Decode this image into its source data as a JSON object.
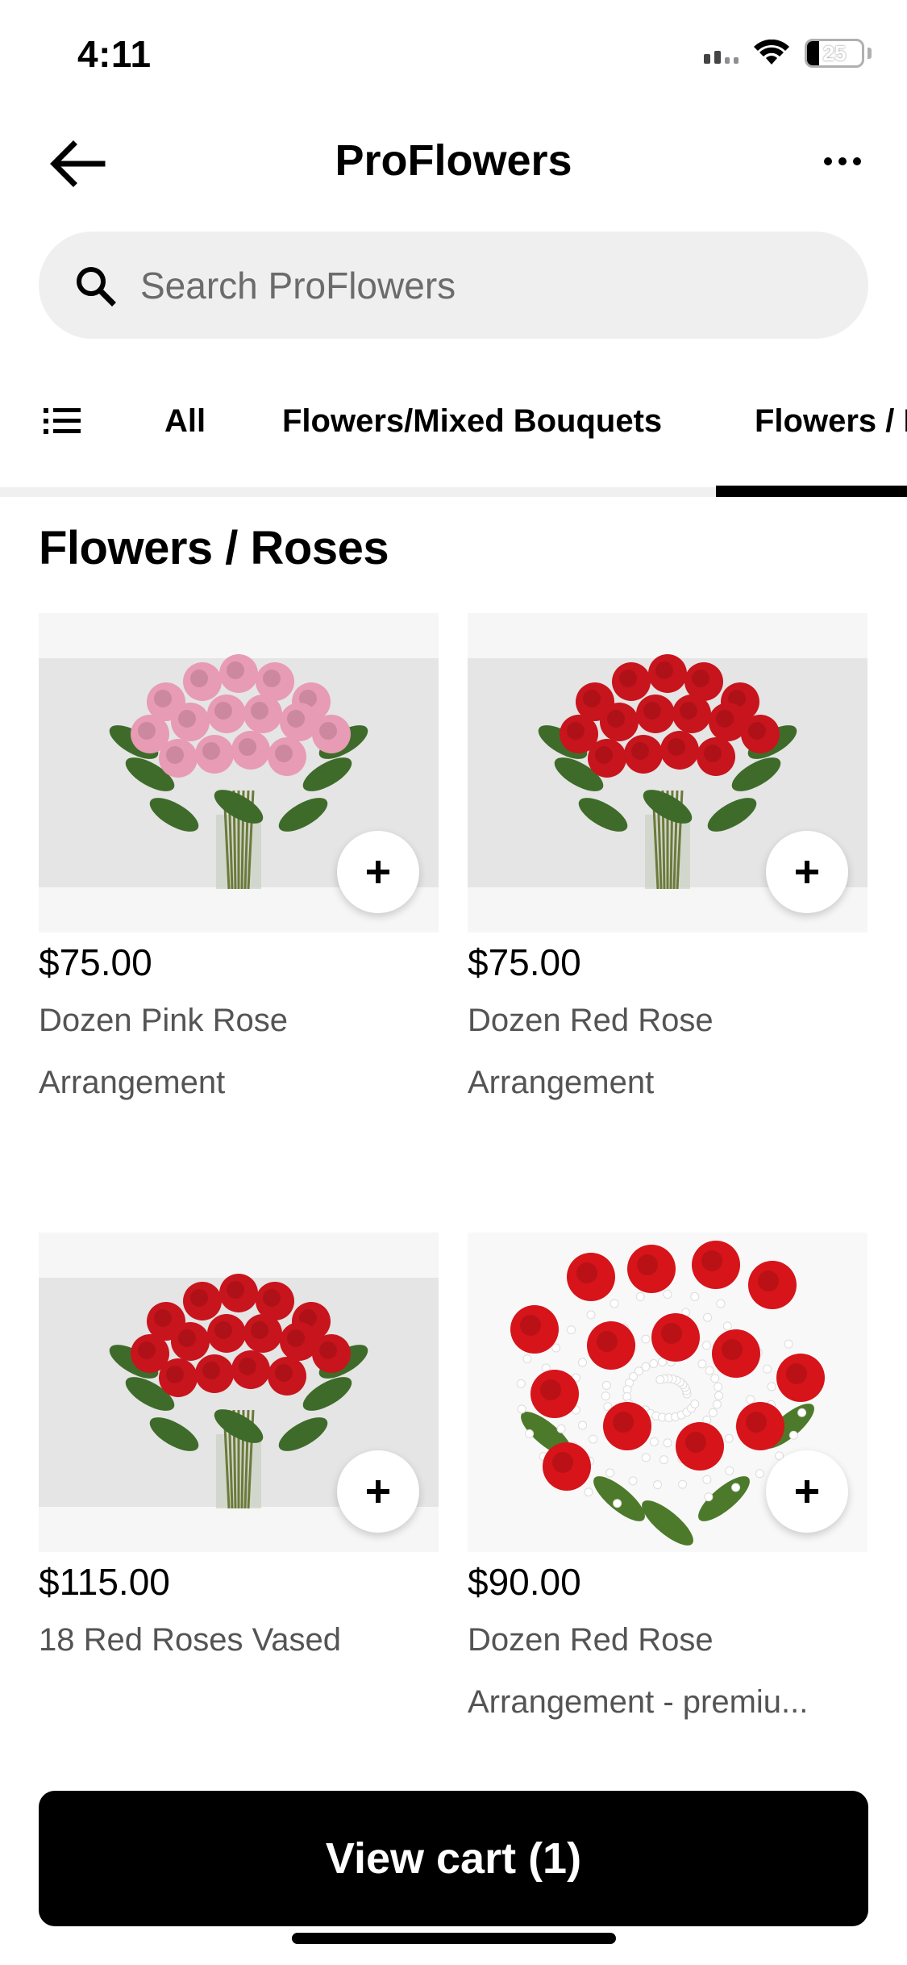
{
  "status_bar": {
    "time": "4:11",
    "battery_level": "25",
    "icons": [
      "signal-icon",
      "wifi-icon",
      "battery-icon"
    ]
  },
  "header": {
    "title": "ProFlowers",
    "back_icon": "back-arrow-icon",
    "more_icon": "more-dots-icon"
  },
  "search": {
    "placeholder": "Search ProFlowers",
    "value": "",
    "icon": "search-icon"
  },
  "tabs": {
    "menu_icon": "list-icon",
    "items": [
      {
        "label": "All",
        "active": false
      },
      {
        "label": "Flowers/Mixed Bouquets",
        "active": false
      },
      {
        "label": "Flowers / Roses",
        "active": true
      }
    ]
  },
  "section": {
    "title": "Flowers / Roses"
  },
  "products": [
    {
      "price": "$75.00",
      "name_line1": "Dozen Pink Rose",
      "name_line2": "Arrangement",
      "flower_color": "#e89bb4"
    },
    {
      "price": "$75.00",
      "name_line1": "Dozen Red Rose",
      "name_line2": "Arrangement",
      "flower_color": "#c8141c"
    },
    {
      "price": "$115.00",
      "name_line1": "18 Red Roses Vased",
      "name_line2": "",
      "flower_color": "#c8141c"
    },
    {
      "price": "$90.00",
      "name_line1": "Dozen Red Rose",
      "name_line2": "Arrangement - premiu...",
      "flower_color": "#d6141a"
    }
  ],
  "add_icon": "plus-icon",
  "cart": {
    "label": "View cart (1)"
  },
  "colors": {
    "accent": "#000000",
    "search_bg": "#efefef",
    "secondary_text": "#545454"
  }
}
